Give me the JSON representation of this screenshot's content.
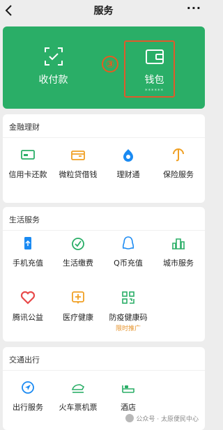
{
  "topbar": {
    "title": "服务",
    "more": "···"
  },
  "hero": {
    "items": [
      {
        "label": "收付款",
        "icon": "scan-icon"
      },
      {
        "label": "钱包",
        "sub": "******",
        "icon": "wallet-icon"
      }
    ]
  },
  "annotation": {
    "step": "③",
    "color": "#e05a2b"
  },
  "sections": [
    {
      "title": "金融理财",
      "items": [
        {
          "label": "信用卡还款",
          "icon": "credit-card-icon"
        },
        {
          "label": "微粒贷借钱",
          "icon": "loan-icon"
        },
        {
          "label": "理财通",
          "icon": "wealth-icon"
        },
        {
          "label": "保险服务",
          "icon": "insurance-icon"
        }
      ]
    },
    {
      "title": "生活服务",
      "items": [
        {
          "label": "手机充值",
          "icon": "phone-icon"
        },
        {
          "label": "生活缴费",
          "icon": "leaf-icon"
        },
        {
          "label": "Q币充值",
          "icon": "penguin-icon"
        },
        {
          "label": "城市服务",
          "icon": "city-icon"
        },
        {
          "label": "腾讯公益",
          "icon": "heart-icon"
        },
        {
          "label": "医疗健康",
          "icon": "medical-icon"
        },
        {
          "label": "防疫健康码",
          "icon": "qr-icon",
          "promo": "限时推广"
        }
      ]
    },
    {
      "title": "交通出行",
      "items": [
        {
          "label": "出行服务",
          "icon": "navigation-icon"
        },
        {
          "label": "火车票机票",
          "icon": "train-icon"
        },
        {
          "label": "酒店",
          "icon": "hotel-icon"
        }
      ]
    }
  ],
  "watermark": "公众号 · 太原便民中心",
  "colors": {
    "brand_green": "#2aae67",
    "icon_blue": "#1a8af2",
    "icon_orange": "#f0a024",
    "icon_green": "#2aae67",
    "icon_red": "#e84a4a"
  }
}
